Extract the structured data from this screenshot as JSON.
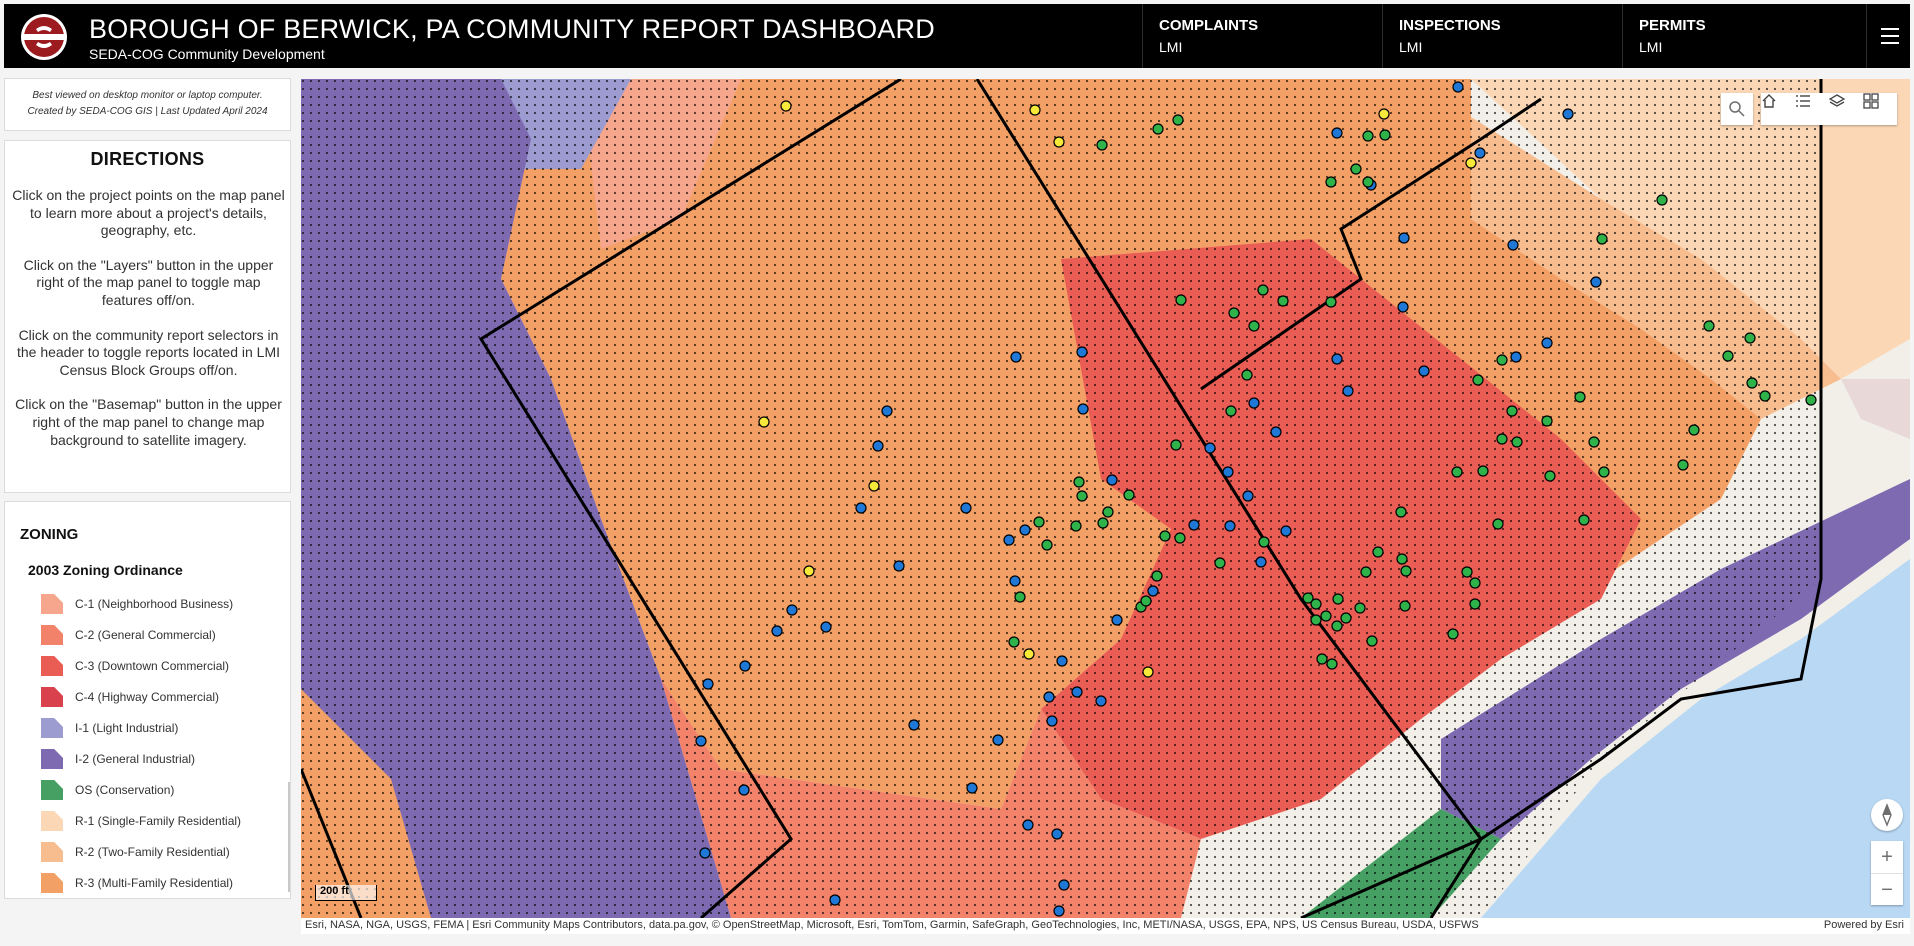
{
  "header": {
    "title": "BOROUGH OF BERWICK, PA COMMUNITY REPORT DASHBOARD",
    "subtitle": "SEDA-COG Community Development",
    "logo_color": "#9b1b1f",
    "selectors": [
      {
        "title": "COMPLAINTS",
        "value": "LMI"
      },
      {
        "title": "INSPECTIONS",
        "value": "LMI"
      },
      {
        "title": "PERMITS",
        "value": "LMI"
      }
    ],
    "menu_icon": "hamburger-menu-icon"
  },
  "sidebar": {
    "note": "Best viewed on desktop monitor or laptop computer.\nCreated by SEDA-COG GIS | Last Updated April 2024",
    "directions": {
      "title": "DIRECTIONS",
      "items": [
        "Click on the project points on the map panel to learn more about a project's details, geography, etc.",
        "Click on the \"Layers\" button in the upper right of the map panel to toggle map features off/on.",
        "Click on the community report selectors in the header to toggle reports located in LMI Census Block Groups off/on.",
        "Click on the \"Basemap\" button in the upper right of the map panel to change map background to satellite imagery."
      ]
    },
    "zoning": {
      "title": "ZONING",
      "subtitle": "2003 Zoning Ordinance",
      "legend": [
        {
          "label": "C-1 (Neighborhood Business)",
          "color": "#f5a68d"
        },
        {
          "label": "C-2 (General Commercial)",
          "color": "#f2836a"
        },
        {
          "label": "C-3 (Downtown Commercial)",
          "color": "#ea5d55"
        },
        {
          "label": "C-4 (Highway Commercial)",
          "color": "#d9414d"
        },
        {
          "label": "I-1 (Light Industrial)",
          "color": "#9c9cd0"
        },
        {
          "label": "I-2 (General Industrial)",
          "color": "#7d6ab0"
        },
        {
          "label": "OS (Conservation)",
          "color": "#46a064"
        },
        {
          "label": "R-1 (Single-Family Residential)",
          "color": "#fbd7b6"
        },
        {
          "label": "R-2 (Two-Family Residential)",
          "color": "#f8bd8e"
        },
        {
          "label": "R-3 (Multi-Family Residential)",
          "color": "#f3a066"
        }
      ]
    }
  },
  "map": {
    "scale_label": "200 ft",
    "toolbar_icons": [
      "search-icon",
      "home-icon",
      "legend-list-icon",
      "layers-icon",
      "basemap-gallery-icon"
    ],
    "compass_icon": "compass-icon",
    "zoom_in": "+",
    "zoom_out": "−",
    "attribution": "Esri, NASA, NGA, USGS, FEMA | Esri Community Maps Contributors, data.pa.gov, © OpenStreetMap, Microsoft, Esri, TomTom, Garmin, SafeGraph, GeoTechnologies, Inc, METI/NASA, USGS, EPA, NPS, US Census Bureau, USDA, USFWS",
    "powered_by": "Powered by Esri",
    "point_colors": {
      "complaints": "#1f78d6",
      "inspections": "#2fb24a",
      "permits": "#f7e93a"
    }
  }
}
